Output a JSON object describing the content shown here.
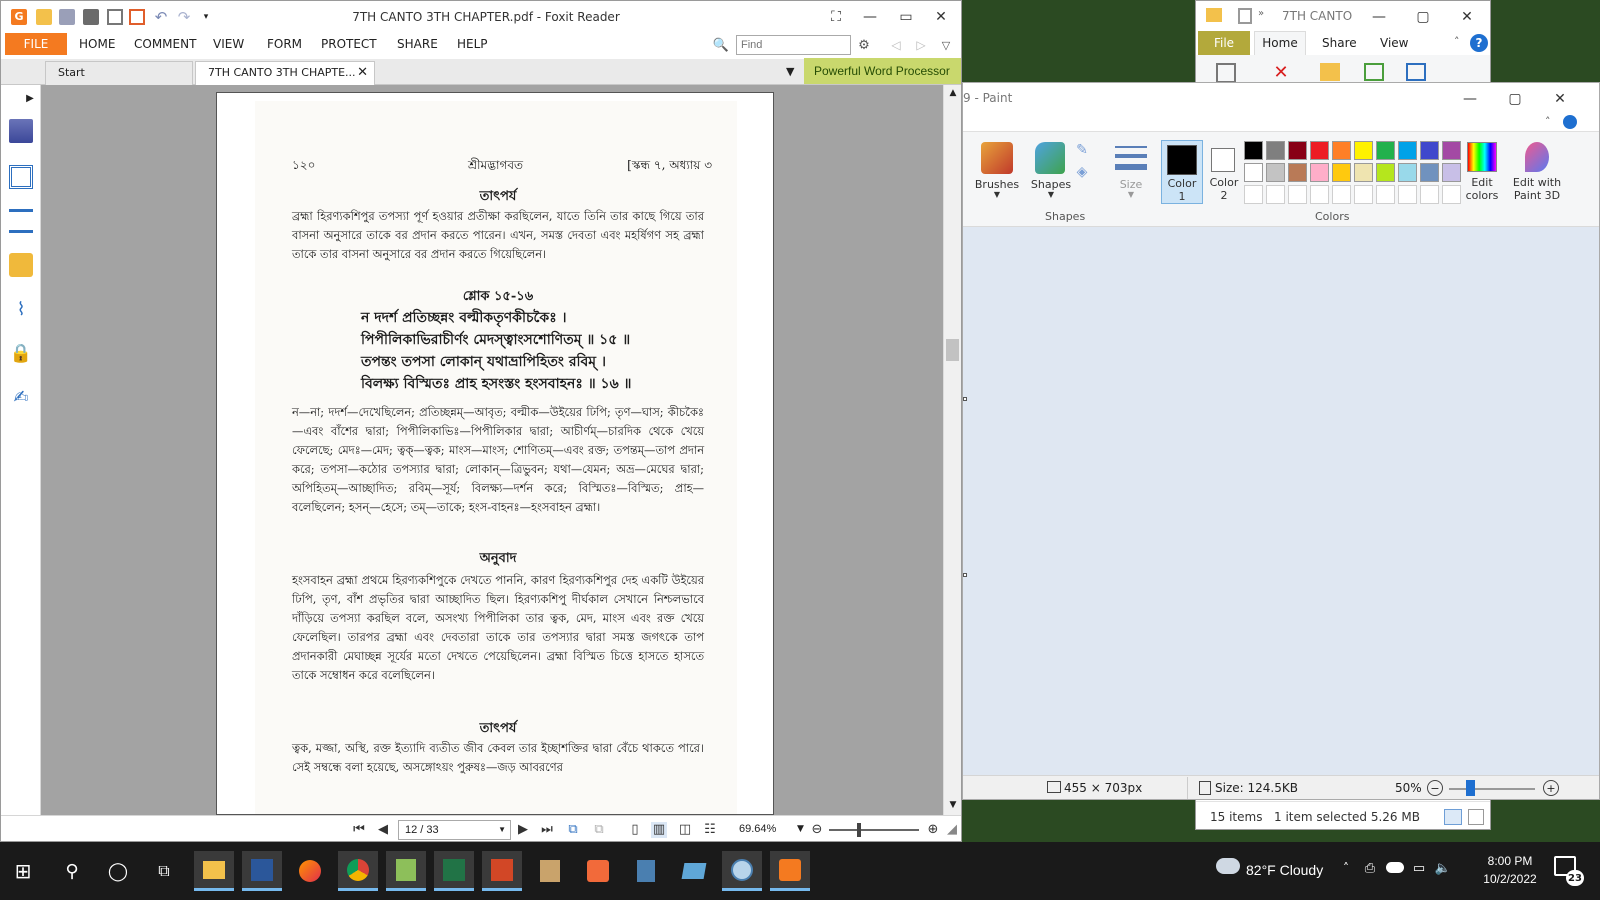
{
  "foxit": {
    "title": "7TH CANTO 3TH CHAPTER.pdf - Foxit Reader",
    "menu": [
      "FILE",
      "HOME",
      "COMMENT",
      "VIEW",
      "FORM",
      "PROTECT",
      "SHARE",
      "HELP"
    ],
    "find_placeholder": "Find",
    "tabs": [
      "Start",
      "7TH CANTO 3TH CHAPTE..."
    ],
    "ad_text": "Powerful Word Processor",
    "page_indicator": "12 / 33",
    "zoom": "69.64%",
    "pdf_page": {
      "header_left": "১২০",
      "header_center": "শ্রীমদ্ভাগবত",
      "header_right": "[স্কন্ধ ৭, অধ্যায় ৩",
      "heading_tatparya_1": "তাৎপর্য",
      "para_1": "ব্রহ্মা হিরণ্যকশিপুর তপস্যা পূর্ণ হওয়ার প্রতীক্ষা করছিলেন, যাতে তিনি তার কাছে গিয়ে তার বাসনা অনুসারে তাকে বর প্রদান করতে পারেন। এখন, সমস্ত দেবতা এবং মহর্ষিগণ সহ ব্রহ্মা তাকে তার বাসনা অনুসারে বর প্রদান করতে গিয়েছিলেন।",
      "shloka_heading": "শ্লোক ১৫-১৬",
      "verse_lines": [
        "ন দদর্শ প্রতিচ্ছন্নং বল্মীকতৃণকীচকৈঃ ।",
        "পিপীলিকাভিরাচীর্ণং মেদস্ত্বাংসশোণিতম্ ॥ ১৫ ॥",
        "তপন্তং তপসা লোকান্ যথাভ্রাপিহিতং রবিম্ ।",
        "বিলক্ষ্য বিস্মিতঃ প্রাহ হসংস্তং হংসবাহনঃ ॥ ১৬ ॥"
      ],
      "synonyms": "ন—না; দদর্শ—দেখেছিলেন; প্রতিচ্ছন্নম্—আবৃত; বল্মীক—উইয়ের ঢিপি; তৃণ—ঘাস; কীচকৈঃ—এবং বাঁশের দ্বারা; পিপীলিকাভিঃ—পিপীলিকার দ্বারা; আচীর্ণম্—চারদিক থেকে খেয়ে ফেলেছে; মেদঃ—মেদ; ত্বক্—ত্বক; মাংস—মাংস; শোণিতম্—এবং রক্ত; তপন্তম্—তাপ প্রদান করে; তপসা—কঠোর তপস্যার দ্বারা; লোকান্—ত্রিভুবন; যথা—যেমন; অভ্র—মেঘের দ্বারা; অপিহিতম্—আচ্ছাদিত; রবিম্—সূর্য; বিলক্ষ্য—দর্শন করে; বিস্মিতঃ—বিস্মিত; প্রাহ—বলেছিলেন; হসন্—হেসে; তম্—তাকে; হংস-বাহনঃ—হংসবাহন ব্রহ্মা।",
      "heading_anuvad": "অনুবাদ",
      "translation": "হংসবাহন ব্রহ্মা প্রথমে হিরণ্যকশিপুকে দেখতে পাননি, কারণ হিরণ্যকশিপুর দেহ একটি উইয়ের ঢিপি, তৃণ, বাঁশ প্রভৃতির দ্বারা আচ্ছাদিত ছিল। হিরণ্যকশিপু দীর্ঘকাল সেখানে নিশ্চলভাবে দাঁড়িয়ে তপস্যা করছিল বলে, অসংখ্য পিপীলিকা তার ত্বক, মেদ, মাংস এবং রক্ত খেয়ে ফেলেছিল। তারপর ব্রহ্মা এবং দেবতারা তাকে তার তপস্যার দ্বারা সমস্ত জগৎকে তাপ প্রদানকারী মেঘাচ্ছন্ন সূর্যের মতো দেখতে পেয়েছিলেন। ব্রহ্মা বিস্মিত চিত্তে হাসতে হাসতে তাকে সম্বোধন করে বলেছিলেন।",
      "heading_tatparya_2": "তাৎপর্য",
      "para_last": "ত্বক, মজ্জা, অস্থি, রক্ত ইত্যাদি ব্যতীত জীব কেবল তার ইচ্ছাশক্তির দ্বারা বেঁচে থাকতে পারে। সেই সম্বন্ধে বলা হয়েছে, অসঙ্গোঽয়ং পুরুষঃ—জড় আবরণের"
    }
  },
  "explorer": {
    "title": "7TH CANTO",
    "tabs": [
      "File",
      "Home",
      "Share",
      "View"
    ],
    "items_count": "15 items",
    "selection": "1 item selected  5.26 MB"
  },
  "paint": {
    "title": "9 - Paint",
    "tools": {
      "brushes": "Brushes",
      "shapes": "Shapes",
      "size": "Size",
      "color1": "Color",
      "color1_num": "1",
      "color2": "Color",
      "color2_num": "2",
      "edit_colors": "Edit colors",
      "edit_paint3d": "Edit with Paint 3D"
    },
    "groups": {
      "shapes": "Shapes",
      "colors": "Colors"
    },
    "palette": [
      "#000000",
      "#7f7f7f",
      "#880015",
      "#ed1c24",
      "#ff7f27",
      "#fff200",
      "#22b14c",
      "#00a2e8",
      "#3f48cc",
      "#a349a4",
      "#ffffff",
      "#c3c3c3",
      "#b97a57",
      "#ffaec9",
      "#ffc90e",
      "#efe4b0",
      "#b5e61d",
      "#99d9ea",
      "#7092be",
      "#c8bfe7"
    ],
    "status": {
      "dimensions": "455 × 703px",
      "size": "Size: 124.5KB",
      "zoom": "50%"
    }
  },
  "taskbar": {
    "weather": "82°F  Cloudy",
    "time": "8:00 PM",
    "date": "10/2/2022",
    "notification_count": "23"
  }
}
